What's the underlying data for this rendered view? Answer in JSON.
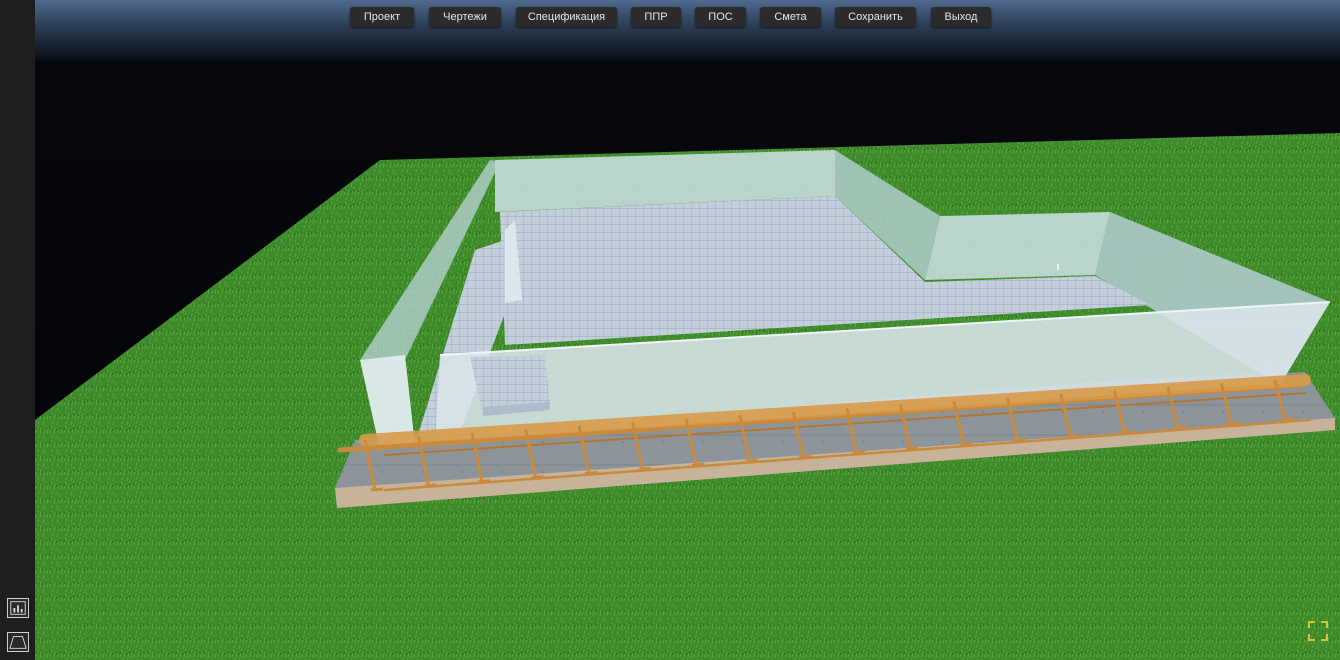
{
  "menu": [
    {
      "id": "project",
      "label": "Проект"
    },
    {
      "id": "drawings",
      "label": "Чертежи"
    },
    {
      "id": "specification",
      "label": "Спецификация"
    },
    {
      "id": "ppr",
      "label": "ППР"
    },
    {
      "id": "pos",
      "label": "ПОС"
    },
    {
      "id": "estimate",
      "label": "Смета"
    },
    {
      "id": "save",
      "label": "Сохранить"
    },
    {
      "id": "exit",
      "label": "Выход"
    }
  ],
  "sidebar": {
    "tools": [
      {
        "id": "chart",
        "icon": "bar-chart-icon"
      },
      {
        "id": "perspective",
        "icon": "perspective-view-icon"
      }
    ]
  },
  "viewport": {
    "fullscreen_icon": "fullscreen-icon",
    "colors": {
      "grass": "#3f8e2a",
      "glass": "#d6e6ec",
      "rebar": "#c98a3e",
      "slab": "#8f969c",
      "accent": "#d8c23a"
    }
  }
}
